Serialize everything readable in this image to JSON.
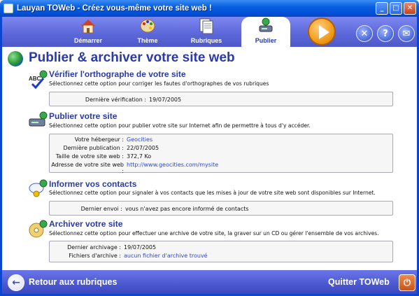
{
  "window": {
    "title": "Lauyan TOWeb - Créez vous-même votre site web !"
  },
  "toolbar": {
    "tabs": [
      {
        "label": "Démarrer",
        "icon": "house-icon"
      },
      {
        "label": "Thème",
        "icon": "palette-icon"
      },
      {
        "label": "Rubriques",
        "icon": "pages-icon"
      },
      {
        "label": "Publier",
        "icon": "upload-drive-icon",
        "active": true
      }
    ],
    "play_icon": "play-icon",
    "tools_icon": "tools-icon",
    "help_label": "?",
    "mail_icon": "mail-icon"
  },
  "page": {
    "title": "Publier & archiver votre site web"
  },
  "sections": {
    "spell": {
      "title": "Vérifier l'orthographe de votre site",
      "desc": "Sélectionnez cette option pour corriger les fautes d'orthographes de vos rubriques",
      "rows": [
        {
          "label": "Dernière vérification :",
          "value": "19/07/2005"
        }
      ]
    },
    "publish": {
      "title": "Publier votre site",
      "desc": "Sélectionnez cette option pour publier votre site sur Internet afin de permettre à tous d'y accéder.",
      "rows": [
        {
          "label": "Votre hébergeur :",
          "value": "Geocities"
        },
        {
          "label": "Dernière publication :",
          "value": "22/07/2005"
        },
        {
          "label": "Taille de votre site web :",
          "value": "372,7 Ko"
        },
        {
          "label": "Adresse de votre site web :",
          "value": "http://www.geocities.com/mysite"
        }
      ]
    },
    "contacts": {
      "title": "Informer vos contacts",
      "desc": "Sélectionnez cette option pour signaler à vos contacts que les mises à jour de votre site web sont disponibles sur Internet.",
      "rows": [
        {
          "label": "Dernier envoi :",
          "value": "vous n'avez pas encore informé de contacts"
        }
      ]
    },
    "archive": {
      "title": "Archiver votre site",
      "desc": "Sélectionnez cette option pour effectuer une archive de votre site, la graver sur un CD ou gérer l'ensemble de vos archives.",
      "rows": [
        {
          "label": "Dernier archivage :",
          "value": "19/07/2005"
        },
        {
          "label": "Fichiers d'archive :",
          "value": "aucun fichier d'archive trouvé"
        }
      ]
    }
  },
  "footer": {
    "back_label": "Retour aux rubriques",
    "quit_label": "Quitter TOWeb"
  }
}
